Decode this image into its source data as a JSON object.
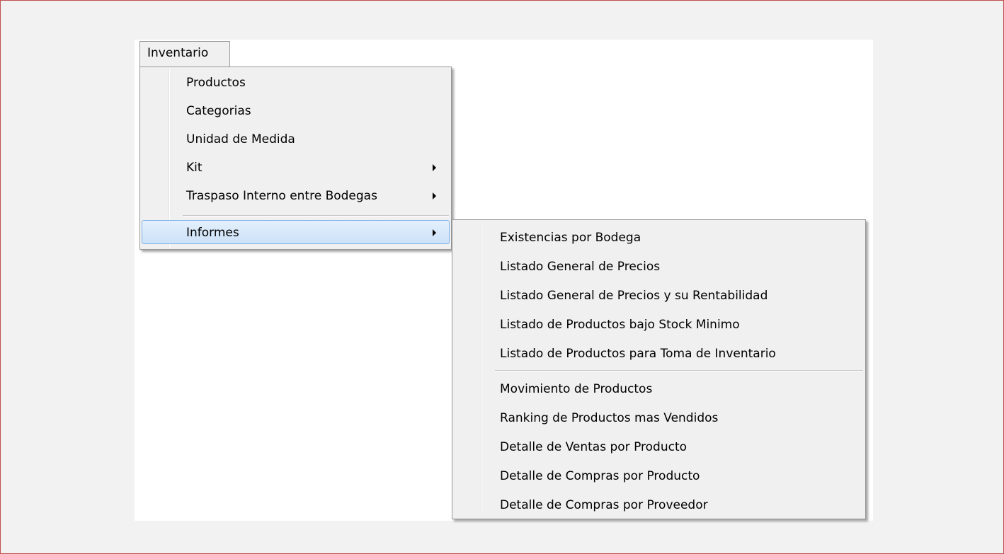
{
  "menubar": {
    "inventario_label": "Inventario"
  },
  "menu": {
    "items": [
      {
        "label": "Productos"
      },
      {
        "label": "Categorias"
      },
      {
        "label": "Unidad de Medida"
      },
      {
        "label": "Kit"
      },
      {
        "label": "Traspaso Interno entre Bodegas"
      },
      {
        "label": "Informes"
      }
    ]
  },
  "submenu_informes": {
    "items": [
      {
        "label": "Existencias por Bodega"
      },
      {
        "label": "Listado General de Precios"
      },
      {
        "label": "Listado General de Precios y su Rentabilidad"
      },
      {
        "label": "Listado de Productos bajo Stock Minimo"
      },
      {
        "label": "Listado de Productos para Toma de Inventario"
      },
      {
        "label": "Movimiento de Productos"
      },
      {
        "label": "Ranking de Productos mas Vendidos"
      },
      {
        "label": "Detalle de Ventas por Producto"
      },
      {
        "label": "Detalle de Compras por Producto"
      },
      {
        "label": "Detalle de Compras por Proveedor"
      }
    ]
  },
  "colors": {
    "hover_border": "#7eb4ea",
    "hover_fill": "#cce1f8",
    "frame_border": "#c0504d"
  }
}
